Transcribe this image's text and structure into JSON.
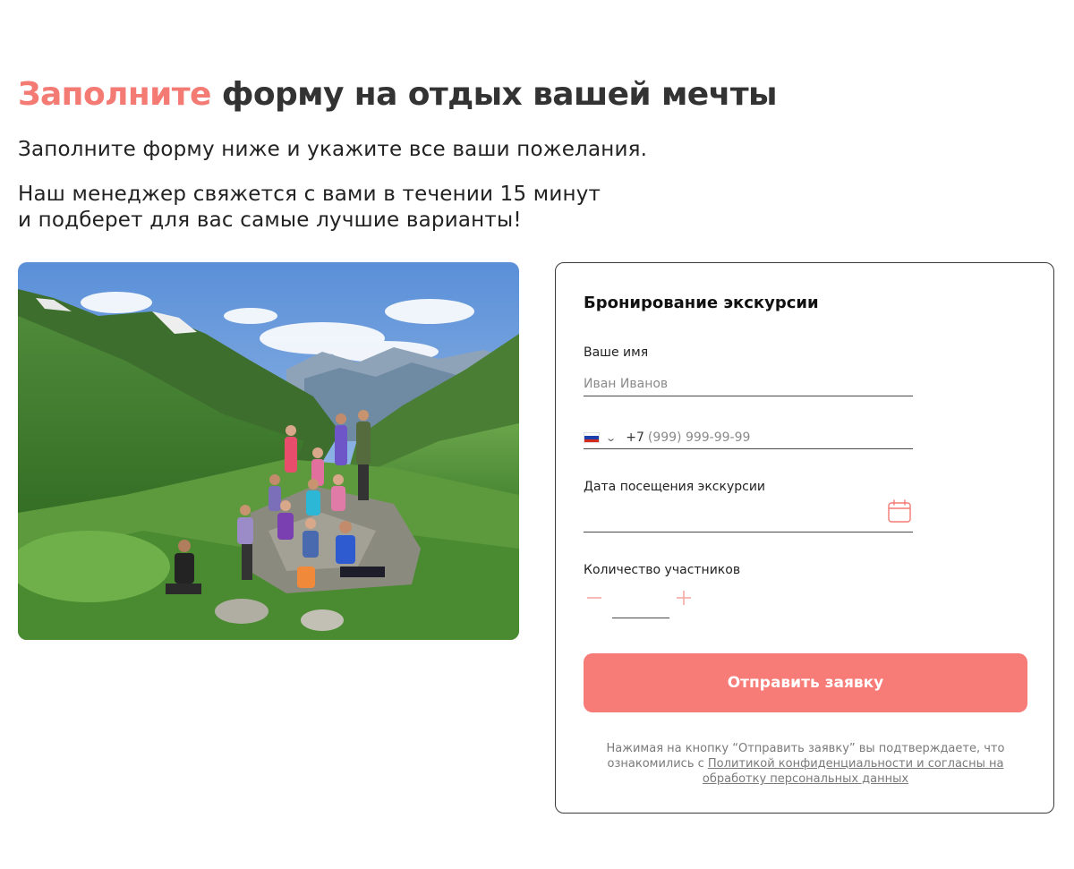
{
  "header": {
    "title_accent": "Заполните",
    "title_rest": "форму на отдых вашей мечты",
    "subtitle": "Заполните форму ниже и укажите все ваши пожелания.",
    "description_line1": "Наш менеджер свяжется с вами в течении 15 минут",
    "description_line2": "и подберет для вас самые лучшие варианты!"
  },
  "photo": {
    "icon": "group-hikers-mountain-valley-photo"
  },
  "form": {
    "title": "Бронирование экскурсии",
    "name": {
      "label": "Ваше имя",
      "placeholder": "Иван Иванов",
      "value": ""
    },
    "phone": {
      "country_flag_icon": "russia-flag-icon",
      "country_code": "+7",
      "placeholder": "(999) 999-99-99",
      "value": ""
    },
    "date": {
      "label": "Дата посещения экскурсии",
      "value": "",
      "icon": "calendar-icon"
    },
    "participants": {
      "label": "Количество участников",
      "value": "",
      "minus_icon": "minus-icon",
      "plus_icon": "plus-icon"
    },
    "submit_label": "Отправить заявку",
    "consent_text": "Нажимая на кнопку “Отправить заявку” вы подтверждаете, что ознакомились с ",
    "consent_link": "Политикой конфиденциальности и согласны на обработку персональных данных"
  },
  "colors": {
    "accent": "#f47a74",
    "button": "#f77b77",
    "text_dark": "#333333",
    "muted": "#7a7a7a",
    "flag_white": "#ffffff",
    "flag_blue": "#1c3faa",
    "flag_red": "#d52b1e"
  }
}
